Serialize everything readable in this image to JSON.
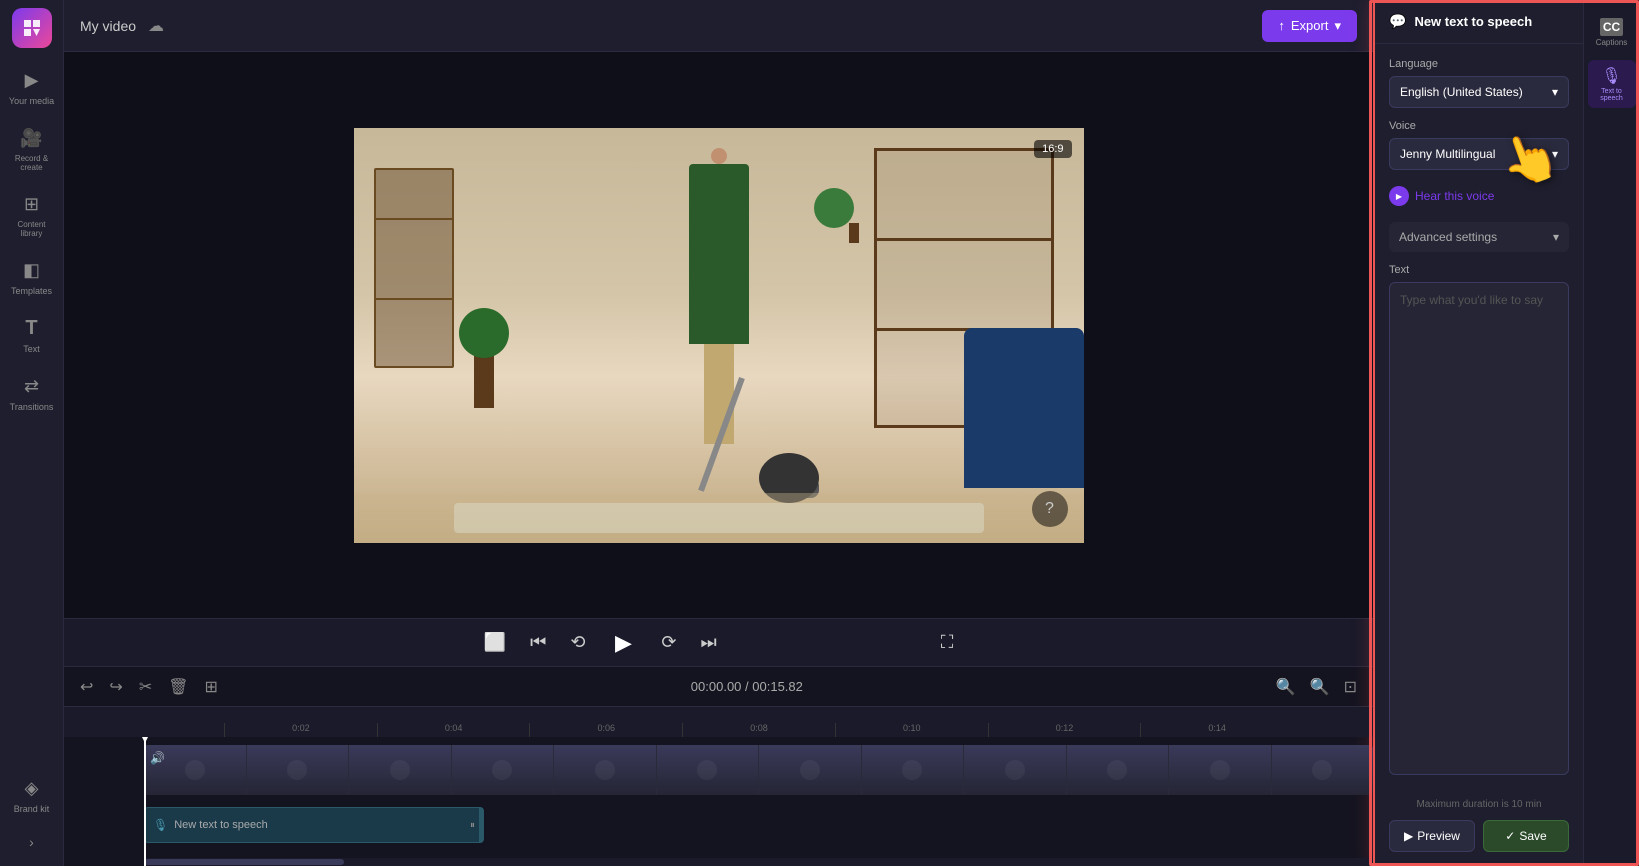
{
  "app": {
    "logo_label": "C",
    "title": "My video",
    "export_label": "Export"
  },
  "sidebar": {
    "items": [
      {
        "id": "your-media",
        "icon": "▶",
        "label": "Your media"
      },
      {
        "id": "record",
        "icon": "🎥",
        "label": "Record &\ncreate"
      },
      {
        "id": "content-library",
        "icon": "⊞",
        "label": "Content\nlibrary"
      },
      {
        "id": "templates",
        "icon": "◧",
        "label": "Templates"
      },
      {
        "id": "text",
        "icon": "T",
        "label": "Text"
      },
      {
        "id": "transitions",
        "icon": "⇄",
        "label": "Transitions"
      },
      {
        "id": "brand",
        "icon": "◈",
        "label": "Brand kit"
      }
    ]
  },
  "video": {
    "aspect_ratio": "16:9"
  },
  "controls": {
    "skip_back": "⏮",
    "rewind": "↺",
    "play": "▶",
    "forward": "↻",
    "skip_fwd": "⏭",
    "fullscreen": "⛶"
  },
  "timeline": {
    "current_time": "00:00.00",
    "total_time": "00:15.82",
    "marks": [
      "0:02",
      "0:04",
      "0:06",
      "0:08",
      "0:10",
      "0:12",
      "0:14"
    ],
    "tts_track_label": "New text to speech"
  },
  "tts_panel": {
    "header_icon": "💬",
    "title": "New text to speech",
    "language_label": "Language",
    "language_value": "English (United States)",
    "voice_label": "Voice",
    "voice_value": "Jenny Multilingual",
    "hear_voice_label": "Hear this voice",
    "advanced_settings_label": "Advanced settings",
    "text_label": "Text",
    "text_placeholder": "Type what you'd like to say",
    "max_duration_label": "Maximum duration is 10 min",
    "preview_label": "Preview",
    "save_label": "Save"
  },
  "right_icons": [
    {
      "id": "captions",
      "icon": "CC",
      "label": "Captions"
    },
    {
      "id": "text-to-speech",
      "icon": "🎙",
      "label": "Text to\nspeech"
    }
  ]
}
